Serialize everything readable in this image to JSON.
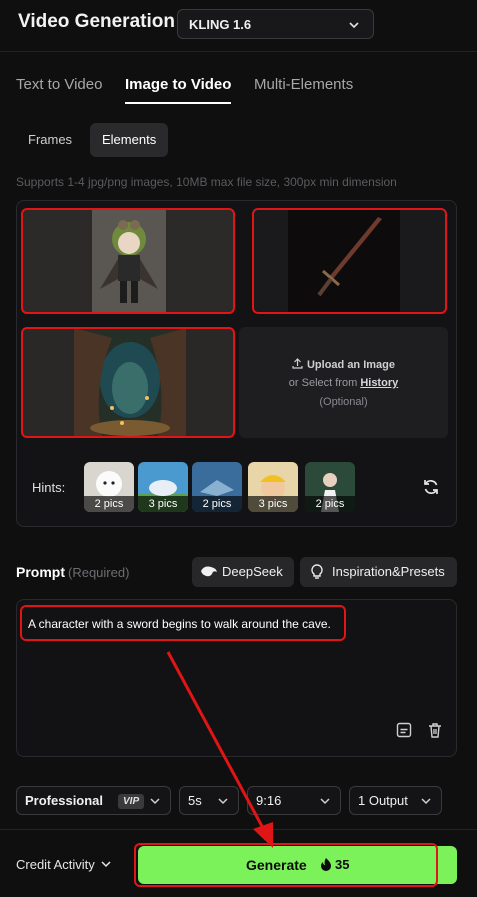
{
  "header": {
    "title": "Video Generation",
    "model": "KLING 1.6"
  },
  "tabs": [
    "Text to Video",
    "Image to Video",
    "Multi-Elements"
  ],
  "subtabs": [
    "Frames",
    "Elements"
  ],
  "upload_hint": "Supports 1-4 jpg/png images, 10MB max file size, 300px min dimension",
  "add_slot": {
    "title": "Upload an Image",
    "or_select": "or Select from",
    "history": "History",
    "optional": "(Optional)"
  },
  "hints": {
    "label": "Hints:",
    "counts": [
      "2 pics",
      "3 pics",
      "2 pics",
      "3 pics",
      "2 pics"
    ]
  },
  "prompt": {
    "label": "Prompt",
    "required": "(Required)",
    "deepseek": "DeepSeek",
    "inspiration": "Inspiration&Presets",
    "text": "A character with a sword begins to walk around the cave."
  },
  "settings": {
    "mode": "Professional",
    "mode_badge": "VIP",
    "duration": "5s",
    "ratio": "9:16",
    "outputs": "1 Output"
  },
  "footer": {
    "credit": "Credit Activity",
    "generate": "Generate",
    "cost": "35"
  },
  "colors": {
    "accent_green": "#7cf25a",
    "annotation_red": "#e01515"
  }
}
